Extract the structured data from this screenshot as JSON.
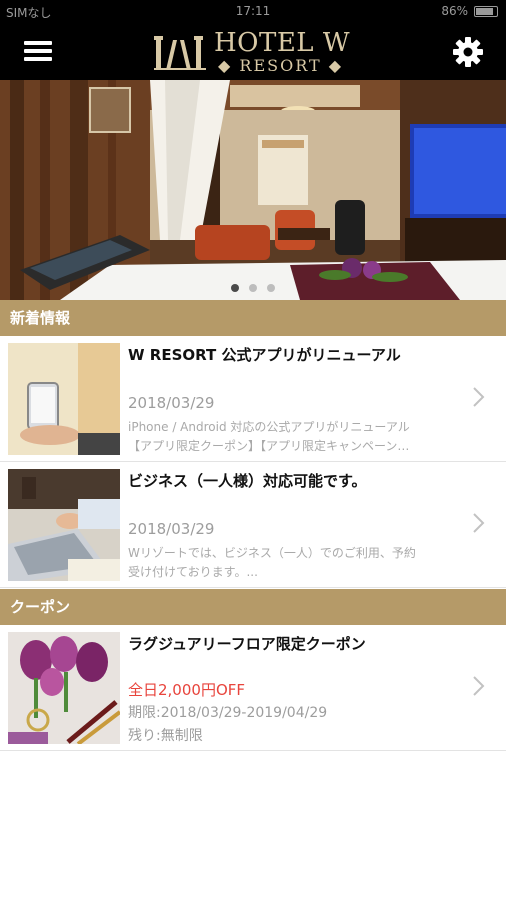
{
  "status_bar": {
    "carrier": "SIMなし",
    "time": "17:11",
    "battery": "86%"
  },
  "header": {
    "logo_line1": "HOTEL W",
    "logo_line2": "◆ RESORT ◆",
    "menu_icon": "hamburger-icon",
    "settings_icon": "gear-icon"
  },
  "carousel": {
    "slide_count": 3,
    "active_index": 0
  },
  "news": {
    "section_title": "新着情報",
    "items": [
      {
        "title": "W RESORT 公式アプリがリニューアル",
        "date": "2018/03/29",
        "desc_line1": "iPhone / Android 対応の公式アプリがリニューアル",
        "desc_line2": "【アプリ限定クーポン】【アプリ限定キャンペーン…"
      },
      {
        "title": "ビジネス（一人様）対応可能です。",
        "date": "2018/03/29",
        "desc_line1": "Wリゾートでは、ビジネス（一人）でのご利用、予約",
        "desc_line2": "受け付けております。..."
      }
    ]
  },
  "coupons": {
    "section_title": "クーポン",
    "items": [
      {
        "title": "ラグジュアリーフロア限定クーポン",
        "discount": "全日2,000円OFF",
        "period": "期限:2018/03/29-2019/04/29",
        "remaining": "残り:無制限"
      }
    ]
  },
  "colors": {
    "header_bg": "#000000",
    "section_bg": "#b59a68",
    "logo_gold": "#d8c9a6",
    "discount_red": "#e8443c"
  }
}
